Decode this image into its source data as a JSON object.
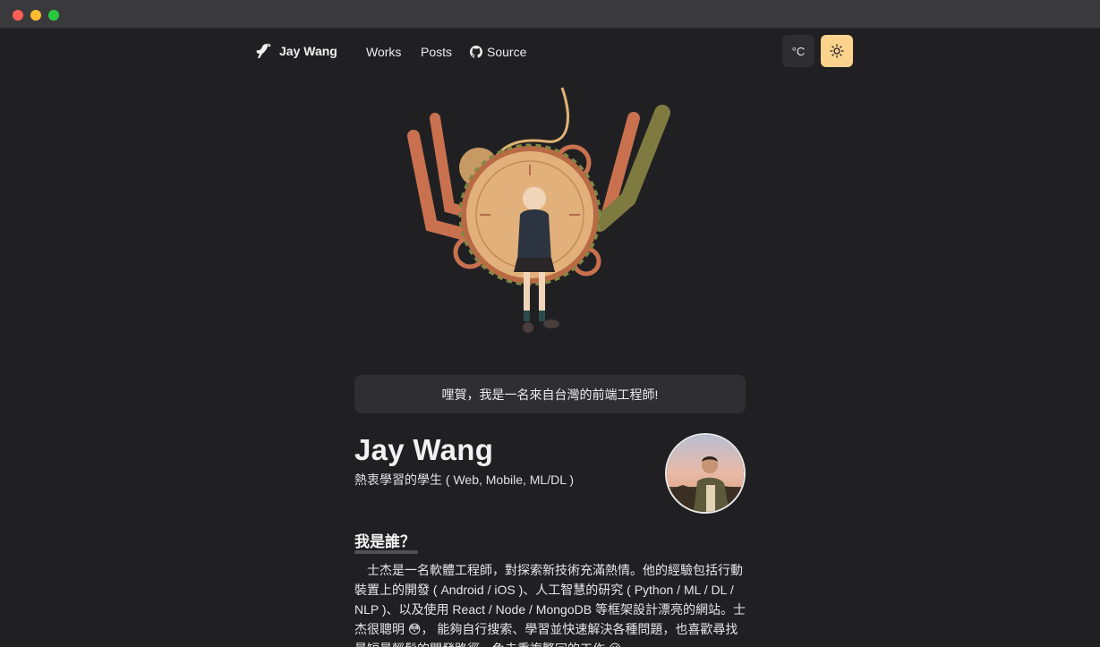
{
  "window": {
    "controls": [
      "close",
      "minimize",
      "maximize"
    ]
  },
  "nav": {
    "brand": "Jay Wang",
    "links": [
      {
        "label": "Works"
      },
      {
        "label": "Posts"
      },
      {
        "label": "Source",
        "icon": "github-icon"
      }
    ],
    "unit_button": "°C",
    "theme_button_icon": "sun-icon"
  },
  "colors": {
    "background": "#202023",
    "accent": "#fbd38d",
    "card": "#2f2f33"
  },
  "hero": {
    "greeting": "哩賀，我是一名來自台灣的前端工程師!"
  },
  "profile": {
    "name": "Jay Wang",
    "subtitle": "熱衷學習的學生 ( Web, Mobile, ML/DL )"
  },
  "about": {
    "title": "我是誰？",
    "body": "士杰是一名軟體工程師，對探索新技術充滿熱情。他的經驗包括行動裝置上的開發 ( Android / iOS )、人工智慧的研究 ( Python / ML / DL / NLP )、以及使用 React / Node / MongoDB 等框架設計漂亮的網站。士杰很聰明 😳， 能夠自行搜索、學習並快速解決各種問題，也喜歡尋找最短最輕鬆的開發路徑，兔去重複繁冗的工作 😉"
  }
}
